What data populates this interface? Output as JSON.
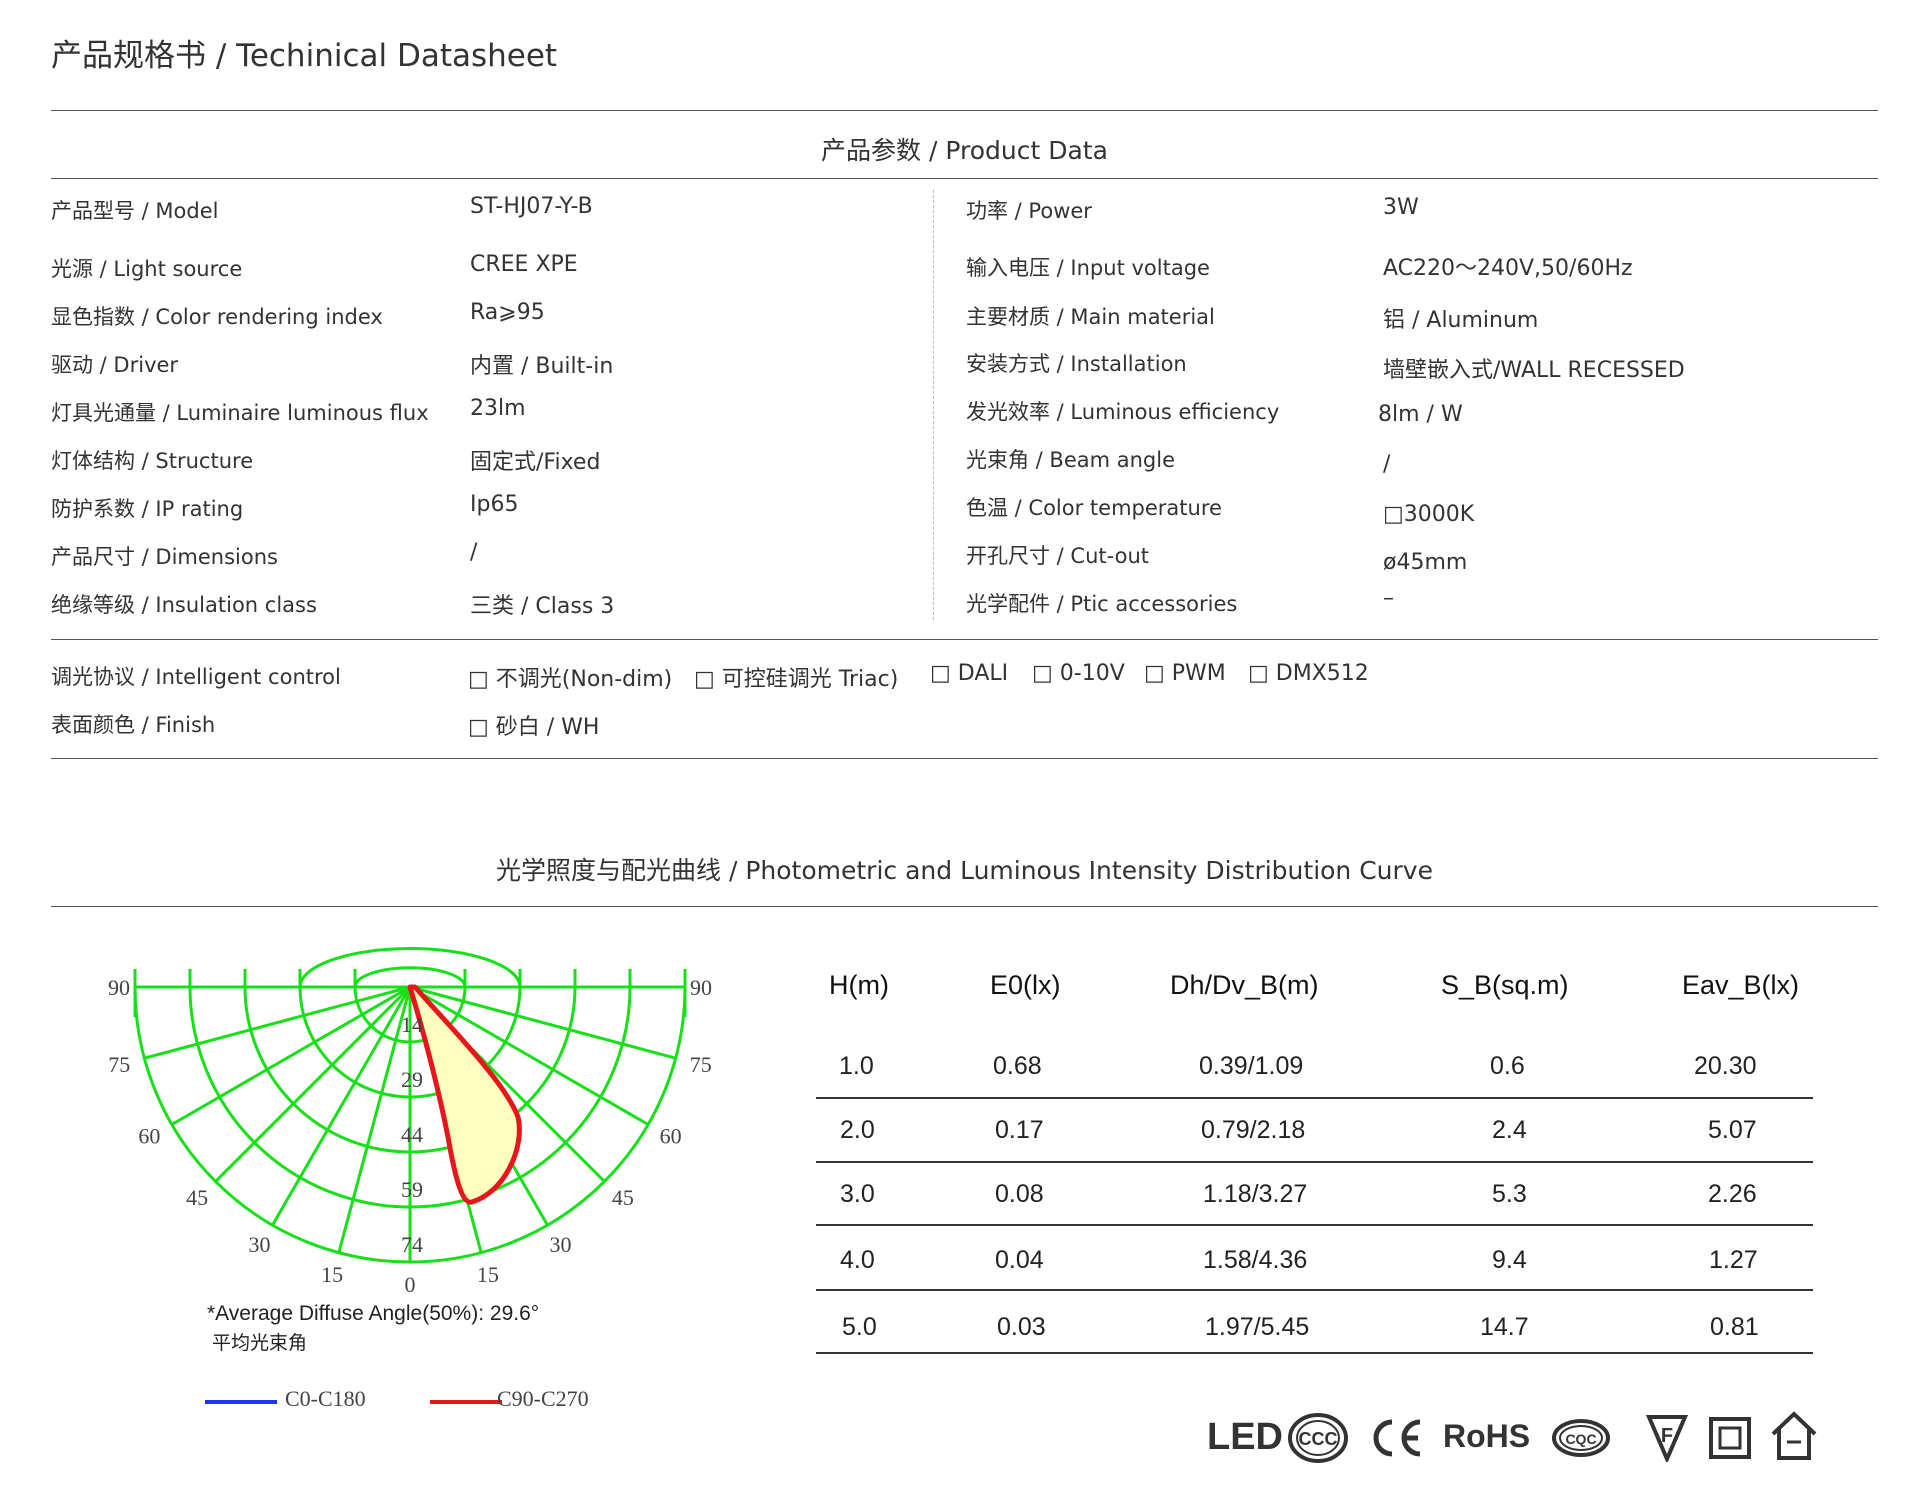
{
  "header": {
    "title": "产品规格书 / Techinical Datasheet"
  },
  "product_section": {
    "title": "产品参数 / Product Data"
  },
  "specs": [
    {
      "label": "产品型号 / Model",
      "value": "ST-HJ07-Y-B",
      "label2": "功率 / Power",
      "value2": "3W"
    },
    {
      "label": "光源 / Light source",
      "value": "CREE XPE",
      "label2": "输入电压 / Input voltage",
      "value2": "AC220～240V,50/60Hz"
    },
    {
      "label": "显色指数 / Color rendering index",
      "value": "Ra⩾95",
      "label2": "主要材质 / Main material",
      "value2": "铝 / Aluminum"
    },
    {
      "label": "驱动 / Driver",
      "value": "内置 / Built-in",
      "label2": "安装方式 / Installation",
      "value2": "墙壁嵌入式/WALL RECESSED"
    },
    {
      "label": "灯具光通量 / Luminaire luminous flux",
      "value": "23lm",
      "label2": "发光效率 / Luminous efficiency",
      "value2": "8lm / W"
    },
    {
      "label": "灯体结构 / Structure",
      "value": "固定式/Fixed",
      "label2": "光束角 / Beam angle",
      "value2": "/"
    },
    {
      "label": "防护系数  / IP  rating",
      "value": "Ip65",
      "label2": "色温 / Color temperature",
      "value2": "□3000K"
    },
    {
      "label": "产品尺寸  / Dimensions",
      "value": "/",
      "label2": "开孔尺寸 / Cut-out",
      "value2": "ø45mm"
    },
    {
      "label": "绝缘等级  / Insulation class",
      "value": "三类 / Class 3",
      "label2": "光学配件 / Ptic accessories",
      "value2": "–"
    }
  ],
  "control": {
    "label": "调光协议  / Intelligent control",
    "options": [
      "□  不调光(Non-dim)",
      "□  可控硅调光  Triac)",
      "□  DALI",
      "□  0-10V",
      "□  PWM",
      "□  DMX512"
    ]
  },
  "finish": {
    "label": "表面颜色  / Finish",
    "option": "□  砂白 / WH"
  },
  "photometric": {
    "title": "光学照度与配光曲线 / Photometric and Luminous Intensity Distribution Curve",
    "angle_labels": [
      "90",
      "75",
      "60",
      "45",
      "30",
      "15",
      "0",
      "15",
      "30",
      "45",
      "60",
      "75",
      "90"
    ],
    "radial_labels": [
      "14",
      "29",
      "44",
      "59",
      "74"
    ],
    "note_line1": "*Average Diffuse Angle(50%): 29.6°",
    "note_line2": "平均光束角",
    "legend": [
      {
        "label": "C0-C180",
        "color": "#1f33ff"
      },
      {
        "label": "C90-C270",
        "color": "#e8161b"
      }
    ],
    "curve_color": "#e8161b",
    "curve_fill": "#ffffc0",
    "grid_color": "#18e018"
  },
  "illuminance_table": {
    "headers": [
      "H(m)",
      "E0(lx)",
      "Dh/Dv_B(m)",
      "S_B(sq.m)",
      "Eav_B(lx)"
    ],
    "rows": [
      [
        "1.0",
        "0.68",
        "0.39/1.09",
        "0.6",
        "20.30"
      ],
      [
        "2.0",
        "0.17",
        "0.79/2.18",
        "2.4",
        "5.07"
      ],
      [
        "3.0",
        "0.08",
        "1.18/3.27",
        "5.3",
        "2.26"
      ],
      [
        "4.0",
        "0.04",
        "1.58/4.36",
        "9.4",
        "1.27"
      ],
      [
        "5.0",
        "0.03",
        "1.97/5.45",
        "14.7",
        "0.81"
      ]
    ]
  },
  "certifications": [
    "LED",
    "CCC",
    "CE",
    "RoHS",
    "CQC",
    "F",
    "class-II",
    "indoor"
  ]
}
